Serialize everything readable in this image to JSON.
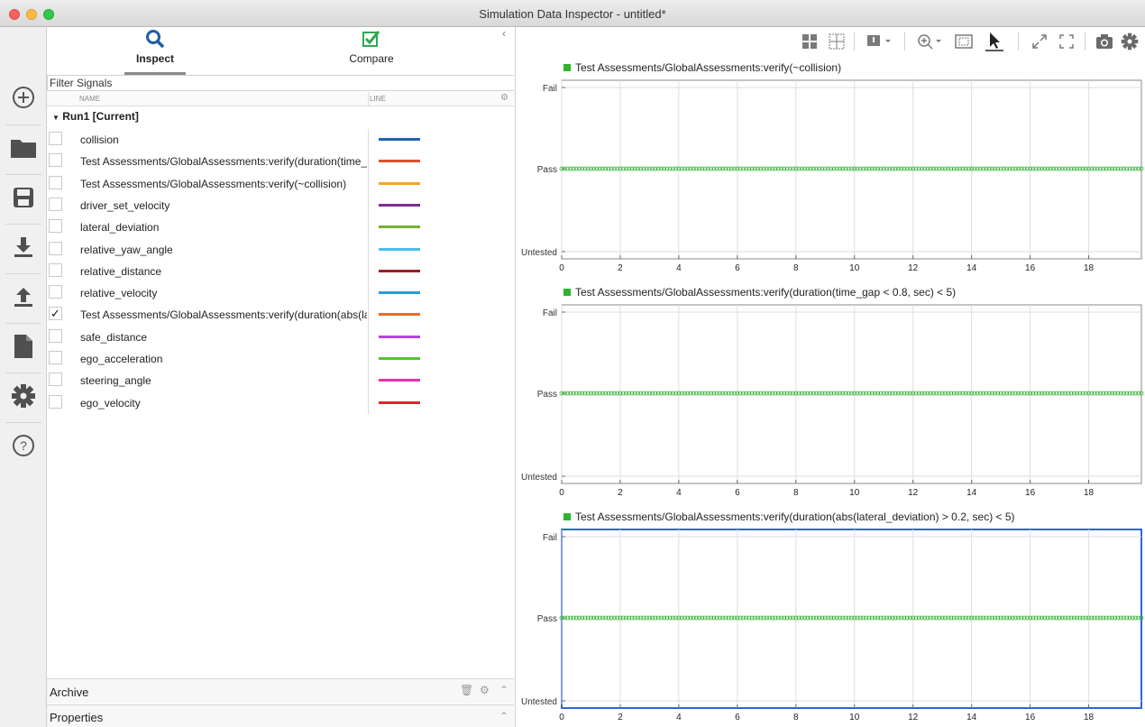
{
  "window": {
    "title": "Simulation Data Inspector - untitled*"
  },
  "sidebar": {
    "buttons": [
      "new-icon",
      "folder-icon",
      "save-icon",
      "import-icon",
      "export-icon",
      "report-icon",
      "settings-icon",
      "help-icon"
    ]
  },
  "tabs": {
    "inspect": "Inspect",
    "compare": "Compare"
  },
  "filter": {
    "placeholder": "Filter Signals"
  },
  "table": {
    "col_name": "NAME",
    "col_line": "LINE",
    "run_label": "Run1 [Current]",
    "signals": [
      {
        "name": "collision",
        "color": "#1f63b5",
        "checked": false
      },
      {
        "name": "Test Assessments/GlobalAssessments:verify(duration(time_g...",
        "color": "#d9532b",
        "checked": false
      },
      {
        "name": "Test Assessments/GlobalAssessments:verify(~collision)",
        "color": "#f2a72a",
        "checked": false
      },
      {
        "name": "driver_set_velocity",
        "color": "#7b2d8e",
        "checked": false
      },
      {
        "name": "lateral_deviation",
        "color": "#75b133",
        "checked": false
      },
      {
        "name": "relative_yaw_angle",
        "color": "#4cbde8",
        "checked": false
      },
      {
        "name": "relative_distance",
        "color": "#a01c26",
        "checked": false
      },
      {
        "name": "relative_velocity",
        "color": "#2d99e0",
        "checked": false
      },
      {
        "name": "Test Assessments/GlobalAssessments:verify(duration(abs(lat...",
        "color": "#f2692b",
        "checked": true
      },
      {
        "name": "safe_distance",
        "color": "#b344e0",
        "checked": false
      },
      {
        "name": "ego_acceleration",
        "color": "#4fc72e",
        "checked": false
      },
      {
        "name": "steering_angle",
        "color": "#ec2fb0",
        "checked": false
      },
      {
        "name": "ego_velocity",
        "color": "#e3242b",
        "checked": false
      }
    ]
  },
  "archive": {
    "label": "Archive"
  },
  "properties": {
    "label": "Properties"
  },
  "toolbar": {
    "icons": [
      "layout-icon",
      "grid-icon",
      "visualization-icon",
      "zoom-icon",
      "fit-icon",
      "cursor-icon",
      "expand-icon",
      "fullscreen-icon",
      "snapshot-icon",
      "settings-icon"
    ]
  },
  "chart_data": [
    {
      "type": "scatter",
      "title": "Test Assessments/GlobalAssessments:verify(~collision)",
      "y_categories": [
        "Untested",
        "Pass",
        "Fail"
      ],
      "x_ticks": [
        0,
        2,
        4,
        6,
        8,
        10,
        12,
        14,
        16,
        18
      ],
      "xlim": [
        0,
        19.8
      ],
      "series": [
        {
          "name": "Test Assessments/GlobalAssessments:verify(~collision)",
          "color": "#2db52d",
          "x_start": 0,
          "x_end": 19.8,
          "x_step": 0.1,
          "value": "Pass"
        }
      ],
      "selected": false
    },
    {
      "type": "scatter",
      "title": "Test Assessments/GlobalAssessments:verify(duration(time_gap < 0.8, sec) < 5)",
      "y_categories": [
        "Untested",
        "Pass",
        "Fail"
      ],
      "x_ticks": [
        0,
        2,
        4,
        6,
        8,
        10,
        12,
        14,
        16,
        18
      ],
      "xlim": [
        0,
        19.8
      ],
      "series": [
        {
          "name": "Test Assessments/GlobalAssessments:verify(duration(time_gap < 0.8, sec) < 5)",
          "color": "#2db52d",
          "x_start": 0,
          "x_end": 19.8,
          "x_step": 0.1,
          "value": "Pass"
        }
      ],
      "selected": false
    },
    {
      "type": "scatter",
      "title": "Test Assessments/GlobalAssessments:verify(duration(abs(lateral_deviation) > 0.2, sec) < 5)",
      "y_categories": [
        "Untested",
        "Pass",
        "Fail"
      ],
      "x_ticks": [
        0,
        2,
        4,
        6,
        8,
        10,
        12,
        14,
        16,
        18
      ],
      "xlim": [
        0,
        19.8
      ],
      "series": [
        {
          "name": "Test Assessments/GlobalAssessments:verify(duration(abs(lateral_deviation) > 0.2, sec) < 5)",
          "color": "#2db52d",
          "x_start": 0,
          "x_end": 19.8,
          "x_step": 0.1,
          "value": "Pass"
        }
      ],
      "selected": true
    }
  ]
}
